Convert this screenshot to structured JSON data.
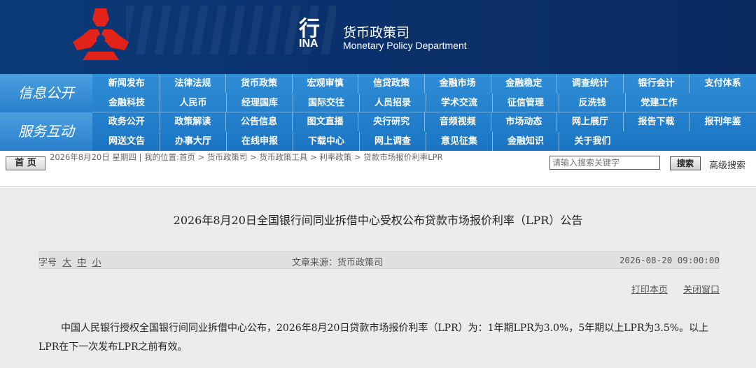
{
  "header": {
    "bank_glyph": "行",
    "bank_suffix": "INA",
    "dept_cn": "货币政策司",
    "dept_en": "Monetary Policy Department"
  },
  "nav": {
    "group1_title": "信息公开",
    "group2_title": "服务互动",
    "row1": [
      "新闻发布",
      "法律法规",
      "货币政策",
      "宏观审慎",
      "信贷政策",
      "金融市场",
      "金融稳定",
      "调查统计",
      "银行会计",
      "支付体系"
    ],
    "row2": [
      "金融科技",
      "人民币",
      "经理国库",
      "国际交往",
      "人员招录",
      "学术交流",
      "征信管理",
      "反洗钱",
      "党建工作"
    ],
    "row3": [
      "政务公开",
      "政策解读",
      "公告信息",
      "图文直播",
      "央行研究",
      "音频视频",
      "市场动态",
      "网上展厅",
      "报告下载",
      "报刊年鉴"
    ],
    "row4": [
      "网送文告",
      "办事大厅",
      "在线申报",
      "下载中心",
      "网上调查",
      "意见征集",
      "金融知识",
      "关于我们"
    ]
  },
  "breadcrumb": {
    "home": "首 页",
    "date": "2026年8月20日 星期四",
    "location_label": "我的位置:",
    "items": [
      "首页",
      "货币政策司",
      "货币政策工具",
      "利率政策",
      "贷款市场报价利率LPR"
    ],
    "separator": ">"
  },
  "search": {
    "placeholder": "请输入搜索关键字",
    "button": "搜索",
    "advanced": "高级搜索"
  },
  "article": {
    "title": "2026年8月20日全国银行间同业拆借中心受权公布贷款市场报价利率（LPR）公告",
    "font_label": "字号",
    "font_large": "大",
    "font_medium": "中",
    "font_small": "小",
    "source": "文章来源：货币政策司",
    "datetime": "2026-08-20 09:00:00",
    "print": "打印本页",
    "close": "关闭窗口",
    "body": "中国人民银行授权全国银行间同业拆借中心公布，2026年8月20日贷款市场报价利率（LPR）为：1年期LPR为3.0%，5年期以上LPR为3.5%。以上LPR在下一次发布LPR之前有效。"
  },
  "colors": {
    "banner": "#0b3a78",
    "nav": "#2a84d0",
    "logo": "#e2231a"
  }
}
